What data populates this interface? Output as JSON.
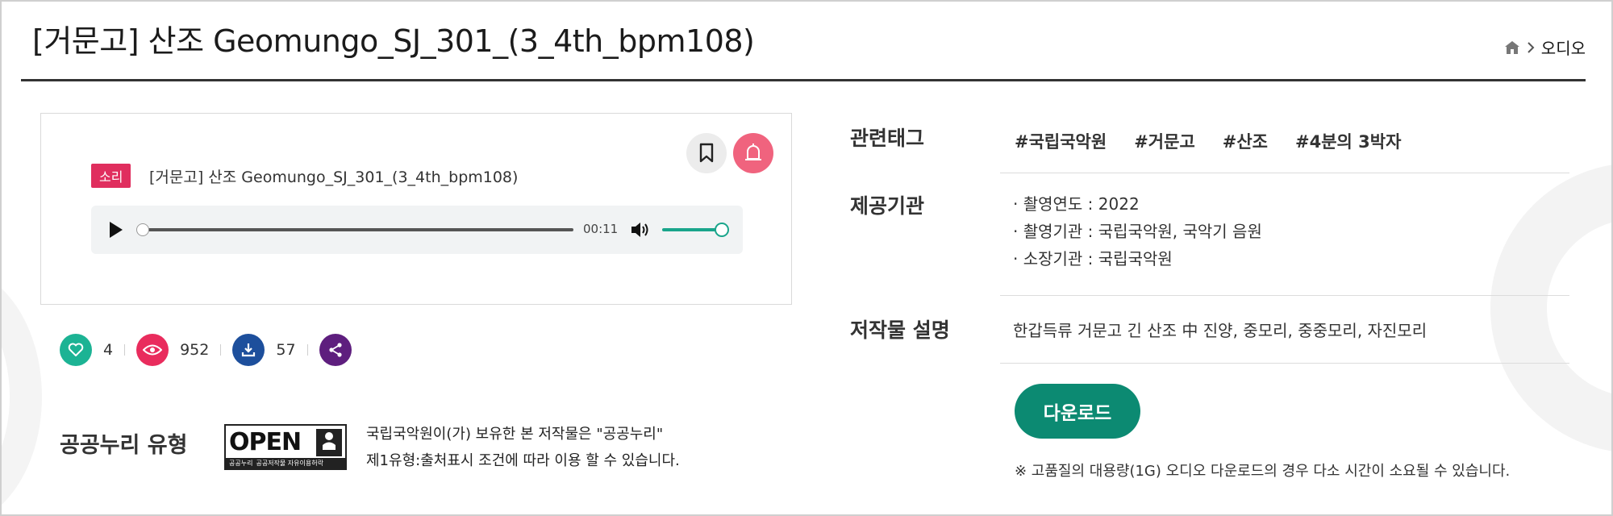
{
  "header": {
    "title": "[거문고] 산조 Geomungo_SJ_301_(3_4th_bpm108)",
    "breadcrumb": {
      "home_icon": "home-icon",
      "separator_icon": "chevron-right-icon",
      "current": "오디오"
    }
  },
  "player": {
    "badge": "소리",
    "track_title": "[거문고] 산조 Geomungo_SJ_301_(3_4th_bpm108)",
    "time": "00:11",
    "progress_fraction": 0.0,
    "volume_fraction": 1.0,
    "icons": {
      "bookmark": "bookmark-icon",
      "alert": "bell-icon",
      "play": "play-icon",
      "volume": "volume-icon"
    },
    "colors": {
      "badge": "#e02e5e",
      "alert": "#f0637e",
      "volume": "#1aa58b"
    }
  },
  "stats": {
    "likes": "4",
    "views": "952",
    "downloads": "57",
    "icons": {
      "like": "heart-icon",
      "view": "eye-icon",
      "download": "download-icon",
      "share": "share-icon"
    },
    "colors": {
      "like": "#1cb394",
      "view": "#e92c5d",
      "download": "#1d4f9c",
      "share": "#5e1e7e"
    }
  },
  "license": {
    "label": "공공누리 유형",
    "logo_text": "OPEN",
    "logo_strip": [
      "공공누리",
      "공공저작물 자유이용허락"
    ],
    "logo_badge": "출처표시",
    "text_line1": "국립국악원이(가) 보유한 본 저작물은 \"공공누리\"",
    "text_line2": "제1유형:출처표시 조건에 따라 이용 할 수 있습니다."
  },
  "info": {
    "tags_label": "관련태그",
    "tags": [
      "#국립국악원",
      "#거문고",
      "#산조",
      "#4분의 3박자"
    ],
    "provider_label": "제공기관",
    "provider_lines": [
      "· 촬영연도 : 2022",
      "· 촬영기관 : 국립국악원, 국악기 음원",
      "· 소장기관 : 국립국악원"
    ],
    "description_label": "저작물 설명",
    "description": "한갑득류 거문고 긴 산조 中 진양, 중모리, 중중모리, 자진모리"
  },
  "download": {
    "button_label": "다운로드",
    "color": "#0c8a72",
    "notice": "※ 고품질의 대용량(1G) 오디오 다운로드의 경우 다소 시간이 소요될 수 있습니다."
  }
}
